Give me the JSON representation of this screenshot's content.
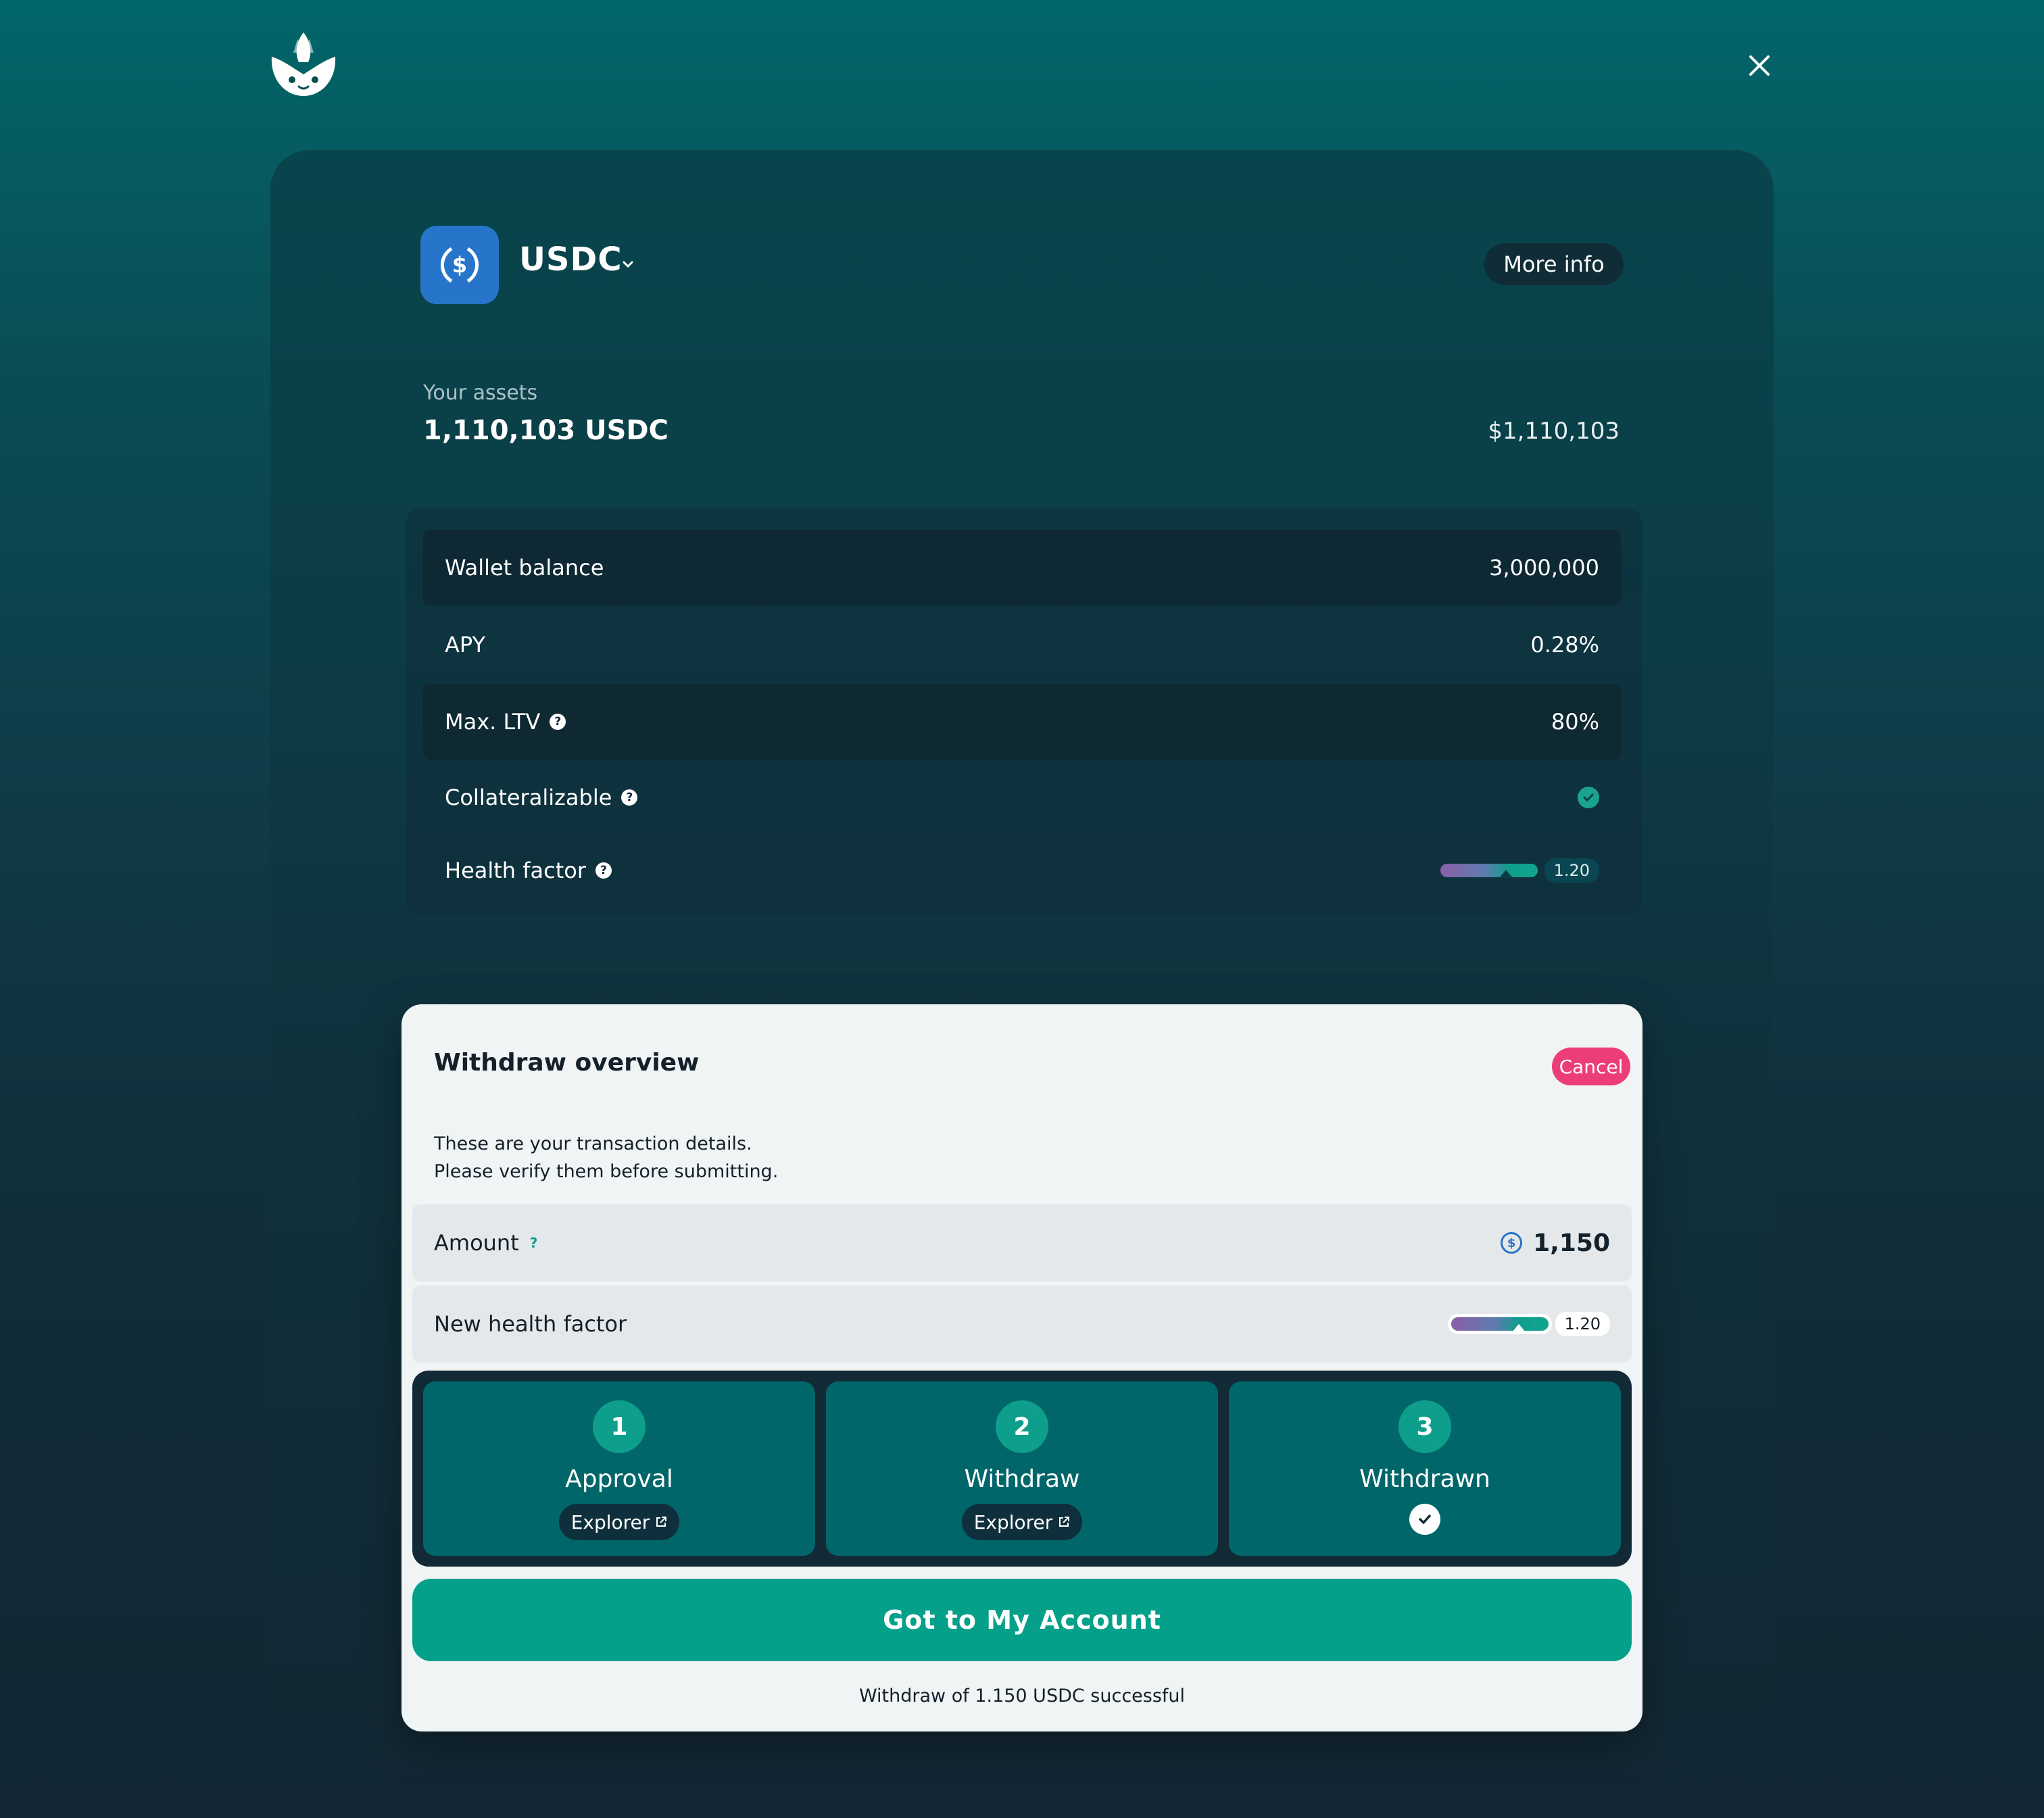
{
  "colors": {
    "brand_teal": "#04a08a",
    "token_blue": "#2775ca",
    "cancel_pink": "#ec3d7a",
    "step_bg": "#01666a"
  },
  "header": {
    "logo_icon": "lotus-logo-icon",
    "close_icon": "close-icon"
  },
  "asset": {
    "token_icon": "usdc-icon",
    "name": "USDC",
    "dropdown_icon": "chevron-down-icon",
    "more_info_label": "More info",
    "assets_label": "Your assets",
    "assets_amount": "1,110,103 USDC",
    "assets_usd": "$1,110,103"
  },
  "stats": {
    "rows": [
      {
        "label": "Wallet balance",
        "value": "3,000,000"
      },
      {
        "label": "APY",
        "value": "0.28%"
      },
      {
        "label": "Max. LTV",
        "value": "80%",
        "help_icon": "question-icon"
      },
      {
        "label": "Collateralizable",
        "value_icon": "check-circle-icon",
        "help_icon": "question-icon"
      },
      {
        "label": "Health factor",
        "help_icon": "question-icon",
        "hf_value": "1.20",
        "hf_level": 0.68
      }
    ]
  },
  "modal": {
    "title": "Withdraw overview",
    "cancel_label": "Cancel",
    "description": "These are your transaction details.\nPlease verify them before submitting.",
    "amount_label": "Amount",
    "amount_help": "?",
    "amount_value": "1,150",
    "amount_icon": "usdc-coin-icon",
    "new_hf_label": "New health factor",
    "new_hf_value": "1.20",
    "new_hf_level": 0.7,
    "steps": [
      {
        "number": "1",
        "title": "Approval",
        "explorer_label": "Explorer",
        "explorer_icon": "external-link-icon"
      },
      {
        "number": "2",
        "title": "Withdraw",
        "explorer_label": "Explorer",
        "explorer_icon": "external-link-icon"
      },
      {
        "number": "3",
        "title": "Withdrawn",
        "status_icon": "check-icon"
      }
    ],
    "cta_label": "Got to My Account",
    "success_message": "Withdraw of 1.150 USDC successful"
  }
}
